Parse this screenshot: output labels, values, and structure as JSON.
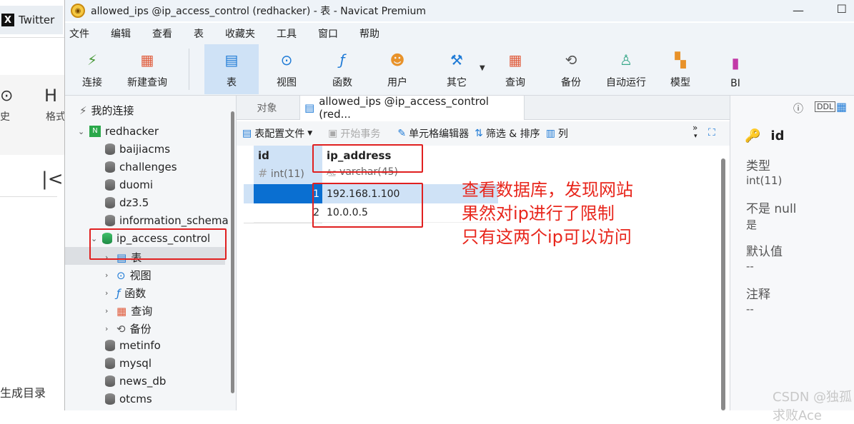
{
  "bg": {
    "tab_label": "Twitter",
    "clock_icon": "⊙",
    "h_icon": "H",
    "history_label": "史",
    "format_label": "格式",
    "collapse_icon": "|<",
    "toc_label": "生成目录"
  },
  "window": {
    "title": "allowed_ips @ip_access_control (redhacker) - 表 - Navicat Premium",
    "minimize": "—",
    "maximize": "☐"
  },
  "menu": [
    "文件",
    "编辑",
    "查看",
    "表",
    "收藏夹",
    "工具",
    "窗口",
    "帮助"
  ],
  "toolbar": [
    {
      "label": "连接",
      "icon": "plug-icon"
    },
    {
      "label": "新建查询",
      "icon": "new-query-icon"
    },
    {
      "label": "表",
      "icon": "table-icon",
      "active": true
    },
    {
      "label": "视图",
      "icon": "view-icon"
    },
    {
      "label": "函数",
      "icon": "function-icon"
    },
    {
      "label": "用户",
      "icon": "user-icon"
    },
    {
      "label": "其它",
      "icon": "tools-icon"
    },
    {
      "label": "查询",
      "icon": "query-icon"
    },
    {
      "label": "备份",
      "icon": "backup-icon"
    },
    {
      "label": "自动运行",
      "icon": "robot-icon"
    },
    {
      "label": "模型",
      "icon": "model-icon"
    },
    {
      "label": "BI",
      "icon": "bi-icon"
    }
  ],
  "sidebar": {
    "root": "我的连接",
    "connection": "redhacker",
    "databases": [
      "baijiacms",
      "challenges",
      "duomi",
      "dz3.5",
      "information_schema",
      "ip_access_control"
    ],
    "children": [
      "表",
      "视图",
      "函数",
      "查询",
      "备份"
    ],
    "databases_after": [
      "metinfo",
      "mysql",
      "news_db",
      "otcms"
    ]
  },
  "tabs": {
    "objects": "对象",
    "active": "allowed_ips @ip_access_control (red..."
  },
  "subbar": {
    "profile": "表配置文件",
    "begin_tx": "开始事务",
    "cell_editor": "单元格编辑器",
    "filter_sort": "筛选 & 排序",
    "columns": "列"
  },
  "grid": {
    "columns": [
      {
        "name": "id",
        "type": "int(11)"
      },
      {
        "name": "ip_address",
        "type": "varchar(45)"
      }
    ],
    "rows": [
      {
        "id": "1",
        "ip": "192.168.1.100"
      },
      {
        "id": "2",
        "ip": "10.0.0.5"
      }
    ]
  },
  "info": {
    "field": "id",
    "type_label": "类型",
    "type_value": "int(11)",
    "notnull_label": "不是 null",
    "notnull_value": "是",
    "default_label": "默认值",
    "default_value": "--",
    "comment_label": "注释",
    "comment_value": "--"
  },
  "annotation": "查看数据库，发现网站\n果然对ip进行了限制\n只有这两个ip可以访问",
  "watermark": "CSDN @独孤求败Ace",
  "colors": {
    "accent": "#0a6fd1",
    "annotation": "#e8261c"
  }
}
